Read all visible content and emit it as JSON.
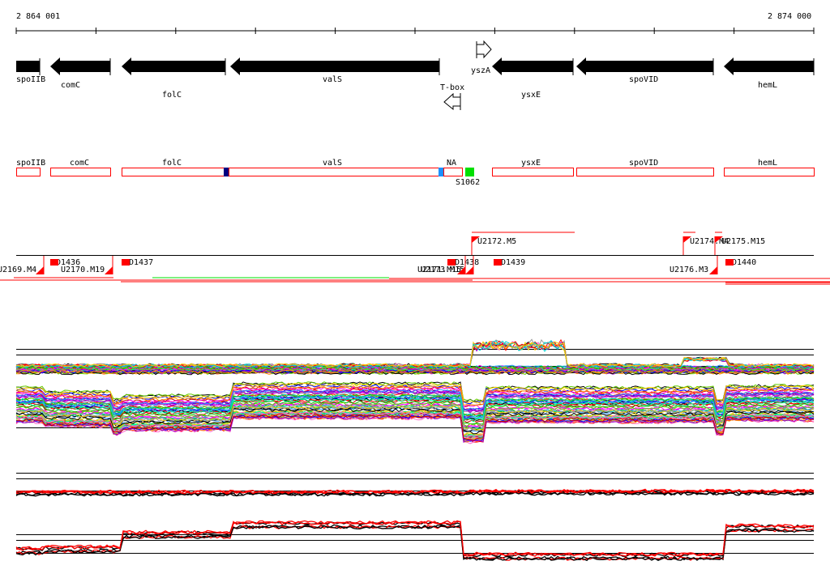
{
  "ruler": {
    "start_label": "2 864 001",
    "end_label": "2 874 000"
  },
  "genes": [
    {
      "name": "spoIIB",
      "strand": "none"
    },
    {
      "name": "comC",
      "strand": "minus"
    },
    {
      "name": "folC",
      "strand": "minus"
    },
    {
      "name": "valS",
      "strand": "minus"
    },
    {
      "name": "yszA",
      "strand": "plus"
    },
    {
      "name": "T-box",
      "strand": "minus"
    },
    {
      "name": "ysxE",
      "strand": "minus"
    },
    {
      "name": "spoVID",
      "strand": "minus"
    },
    {
      "name": "hemL",
      "strand": "minus"
    }
  ],
  "annotation_boxes": [
    "spoIIB",
    "comC",
    "folC",
    "valS",
    "NA",
    "ysxE",
    "spoVID",
    "hemL"
  ],
  "site_label": "S1062",
  "transcripts": {
    "upper": [
      "U2172.M5",
      "U2174.M4",
      "U2175.M15"
    ],
    "lower": [
      "U2169.M4",
      "D1436",
      "U2170.M19",
      "D1437",
      "U2171.M15",
      "U2173.M15",
      "D1438",
      "D1439",
      "U2176.M3",
      "D1440"
    ]
  },
  "colors": {
    "gene": "#000000",
    "box": "#ff0000",
    "site": "#00e000",
    "marker_dark": "#000080",
    "marker_light": "#1e90ff",
    "transcript": "#ff0000",
    "trace_palette": [
      "#000000",
      "#ff0000",
      "#00c000",
      "#0000ff",
      "#ff00ff",
      "#00cccc",
      "#ffcc00",
      "#9900cc",
      "#ff8800",
      "#66cc00",
      "#ff66cc",
      "#3399ff",
      "#999999",
      "#cc0000",
      "#00ff99"
    ]
  }
}
